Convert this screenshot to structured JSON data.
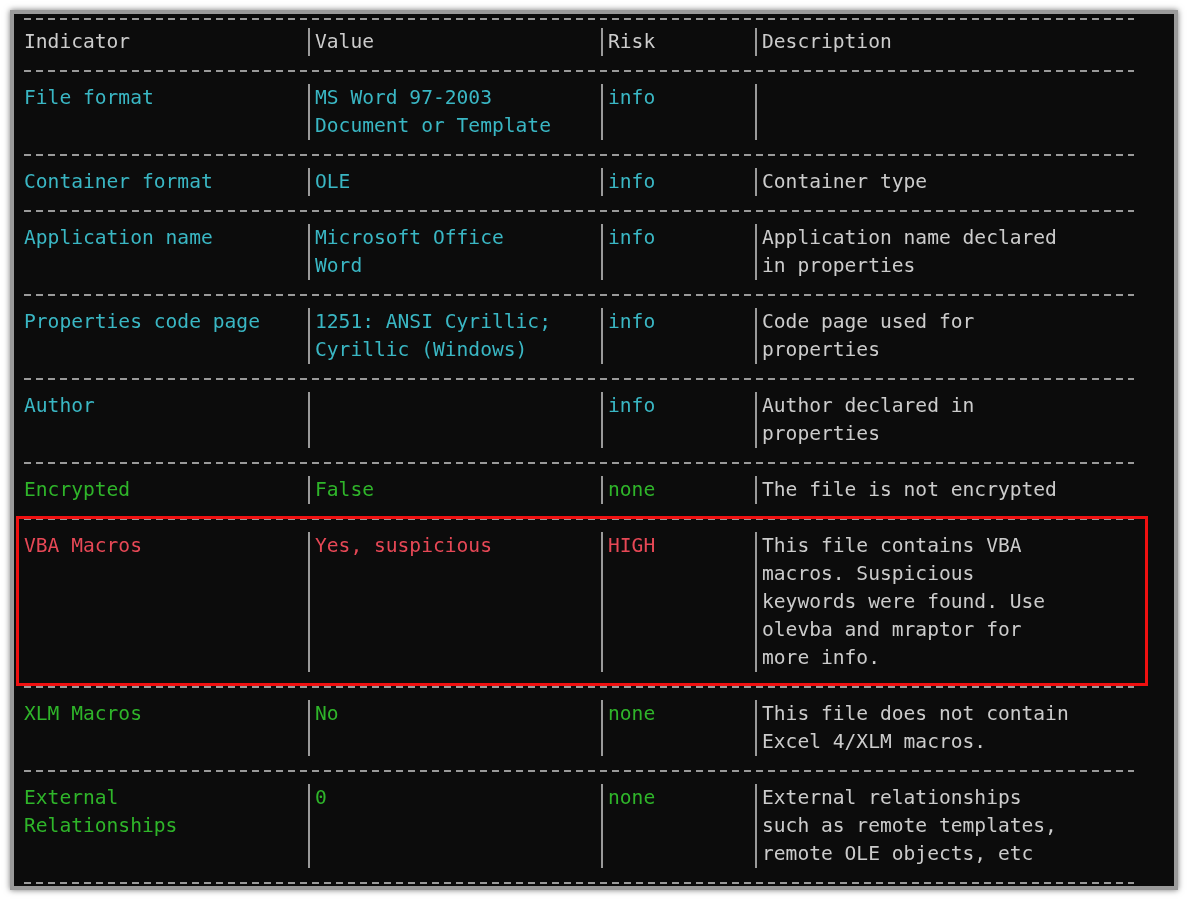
{
  "table": {
    "columns": [
      "Indicator",
      "Value",
      "Risk",
      "Description"
    ],
    "rows": [
      {
        "kind": "info",
        "highlighted": false,
        "indicator": "File format",
        "value": "MS Word 97-2003\nDocument or Template",
        "risk": "info",
        "description": ""
      },
      {
        "kind": "info",
        "highlighted": false,
        "indicator": "Container format",
        "value": "OLE",
        "risk": "info",
        "description": "Container type"
      },
      {
        "kind": "info",
        "highlighted": false,
        "indicator": "Application name",
        "value": "Microsoft Office\nWord",
        "risk": "info",
        "description": "Application name declared\nin properties"
      },
      {
        "kind": "info",
        "highlighted": false,
        "indicator": "Properties code page",
        "value": "1251: ANSI Cyrillic;\nCyrillic (Windows)",
        "risk": "info",
        "description": "Code page used for\nproperties"
      },
      {
        "kind": "info",
        "highlighted": false,
        "indicator": "Author",
        "value": "",
        "risk": "info",
        "description": "Author declared in\nproperties"
      },
      {
        "kind": "none",
        "highlighted": false,
        "indicator": "Encrypted",
        "value": "False",
        "risk": "none",
        "description": "The file is not encrypted"
      },
      {
        "kind": "high",
        "highlighted": true,
        "indicator": "VBA Macros",
        "value": "Yes, suspicious",
        "risk": "HIGH",
        "description": "This file contains VBA\nmacros. Suspicious\nkeywords were found. Use\nolevba and mraptor for\nmore info."
      },
      {
        "kind": "none",
        "highlighted": false,
        "indicator": "XLM Macros",
        "value": "No",
        "risk": "none",
        "description": "This file does not contain\nExcel 4/XLM macros."
      },
      {
        "kind": "none",
        "highlighted": false,
        "indicator": "External\nRelationships",
        "value": "0",
        "risk": "none",
        "description": "External relationships\nsuch as remote templates,\nremote OLE objects, etc"
      }
    ]
  }
}
